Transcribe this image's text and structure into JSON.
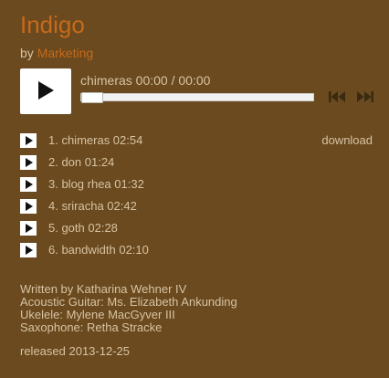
{
  "album": {
    "title": "Indigo",
    "by_prefix": "by",
    "artist": "Marketing"
  },
  "player": {
    "now_playing": "chimeras 00:00 / 00:00",
    "progress_fraction": 0,
    "icons": {
      "play": "play-icon",
      "prev": "previous-track-icon",
      "next": "next-track-icon"
    }
  },
  "tracks": [
    {
      "label": "1. chimeras 02:54",
      "download": "download"
    },
    {
      "label": "2. don 01:24"
    },
    {
      "label": "3. blog rhea 01:32"
    },
    {
      "label": "4. sriracha 02:42"
    },
    {
      "label": "5. goth 02:28"
    },
    {
      "label": "6. bandwidth 02:10"
    }
  ],
  "credits": [
    "Written by Katharina Wehner IV",
    "Acoustic Guitar: Ms. Elizabeth Ankunding",
    "Ukelele: Mylene MacGyver III",
    "Saxophone: Retha Stracke"
  ],
  "released": "released 2013-12-25",
  "colors": {
    "background": "#6a4a1e",
    "accent": "#c76a1b",
    "text": "#d8c3a4"
  }
}
